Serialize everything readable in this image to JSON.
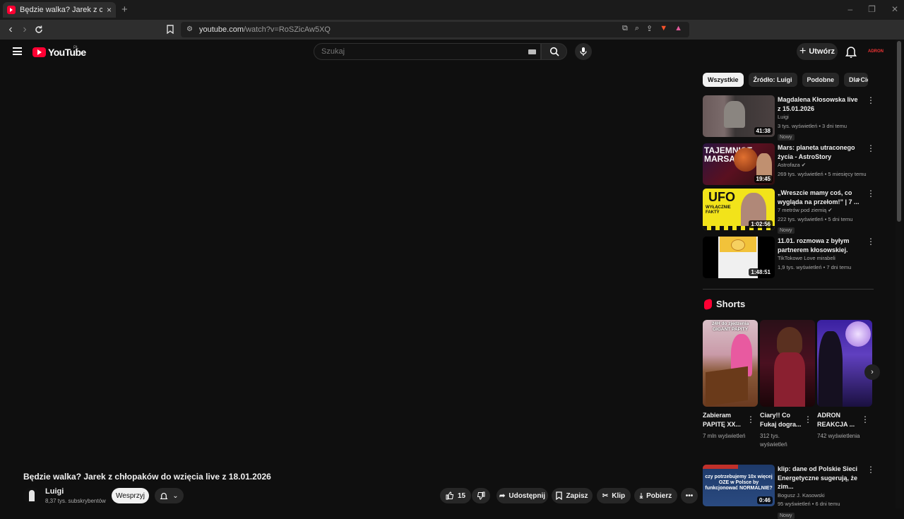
{
  "browser": {
    "tab_title": "Będzie walka? Jarek z chłopaków",
    "tab_close": "×",
    "new_tab": "+",
    "url_host": "youtube.com",
    "url_path": "/watch?v=RoSZicAw5XQ"
  },
  "header": {
    "logo_text": "YouTube",
    "country_code": "PL",
    "search_placeholder": "Szukaj",
    "create_label": "Utwórz",
    "avatar_text": "ADRON"
  },
  "video": {
    "title": "Będzie walka? Jarek z chłopaków do wzięcia live z 18.01.2026",
    "channel_name": "Luigi",
    "channel_subs": "8,37 tys. subskrybentów",
    "support_label": "Wesprzyj",
    "like_count": "15",
    "share_label": "Udostępnij",
    "save_label": "Zapisz",
    "clip_label": "Klip",
    "download_label": "Pobierz"
  },
  "chips": [
    "Wszystkie",
    "Źródło: Luigi",
    "Podobne",
    "Dla Ciebie"
  ],
  "recommendations": [
    {
      "title": "Magdalena Kłosowska live z 15.01.2026",
      "channel": "Luigi",
      "verified": false,
      "meta": "3 tys. wyświetleń • 3 dni temu",
      "badge": "Nowy",
      "duration": "41:38",
      "thumb": "a"
    },
    {
      "title": "Mars: planeta utraconego życia - AstroStory",
      "channel": "Astrofaza",
      "verified": true,
      "meta": "269 tys. wyświetleń • 5 miesięcy temu",
      "badge": "",
      "duration": "19:45",
      "thumb": "b",
      "thumb_text": "TAJEMNICE MARSA"
    },
    {
      "title": "„Wreszcie mamy coś, co wygląda na przełom!” | 7 ...",
      "channel": "7 metrów pod ziemią",
      "verified": true,
      "meta": "222 tys. wyświetleń • 5 dni temu",
      "badge": "Nowy",
      "duration": "1:02:56",
      "thumb": "c",
      "thumb_text": "UFO",
      "thumb_sub": "WYŁĄCZNIE FAKTY"
    },
    {
      "title": "11.01. rozmowa z byłym partnerem kłosowskiej.",
      "channel": "TikTokowe Love mirabeli",
      "verified": false,
      "meta": "1,9 tys. wyświetleń • 7 dni temu",
      "badge": "",
      "duration": "1:48:51",
      "thumb": "d"
    },
    {
      "title": "klip: dane od Polskie Sieci Energetyczne sugerują, że zim...",
      "channel": "Bogusz J. Kasowski",
      "verified": false,
      "meta": "95 wyświetleń • 6 dni temu",
      "badge": "Nowy",
      "duration": "0:46",
      "thumb": "e",
      "thumb_text": "czy potrzebujemy 10x więcej OZE w Polsce by funkcjonować NORMALNIE?"
    }
  ],
  "shorts": {
    "heading": "Shorts",
    "items": [
      {
        "title": "Zabieram PAPITĘ XX...",
        "views": "7 mln wyświetleń",
        "thumb_text": "24H do zjedzenia GIGANT PAPITY"
      },
      {
        "title": "Ciary!! Co Fukaj dogra...",
        "views": "312 tys. wyświetleń",
        "thumb_text": ""
      },
      {
        "title": "ADRON REAKCJA ...",
        "views": "742 wyświetlenia",
        "thumb_text": ""
      }
    ]
  },
  "colors": {
    "background": "#0f0f0f",
    "accent": "#ff0033",
    "chip_bg": "#272727"
  }
}
